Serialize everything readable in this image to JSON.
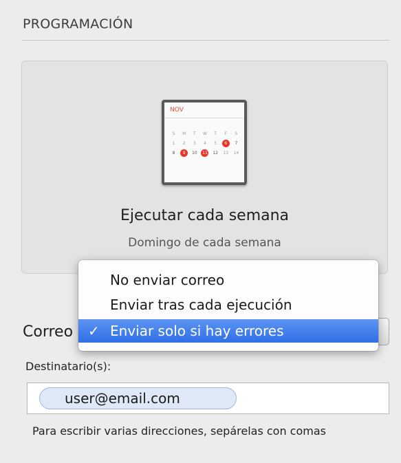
{
  "section": {
    "title": "PROGRAMACIÓN"
  },
  "schedule": {
    "calendar": {
      "month": "NOV",
      "weekdays": [
        "S",
        "M",
        "T",
        "W",
        "T",
        "F",
        "S"
      ],
      "week1": [
        "1",
        "2",
        "3",
        "4",
        "5",
        "6",
        "7"
      ],
      "week2": [
        "8",
        "9",
        "10",
        "11",
        "12",
        "13",
        "14"
      ]
    },
    "title": "Ejecutar cada semana",
    "subtitle": "Domingo de cada semana"
  },
  "email": {
    "label": "Correo",
    "menu": {
      "items": [
        {
          "label": "No enviar correo",
          "selected": false
        },
        {
          "label": "Enviar tras cada ejecución",
          "selected": false
        },
        {
          "label": "Enviar solo si hay errores",
          "selected": true
        }
      ],
      "check_glyph": "✓"
    }
  },
  "recipients": {
    "label": "Destinatario(s):",
    "tokens": [
      "user@email.com"
    ],
    "hint": "Para escribir varias direcciones, sepárelas con comas"
  },
  "colors": {
    "accent": "#3d7cf0",
    "calendar_highlight": "#e8352a"
  }
}
